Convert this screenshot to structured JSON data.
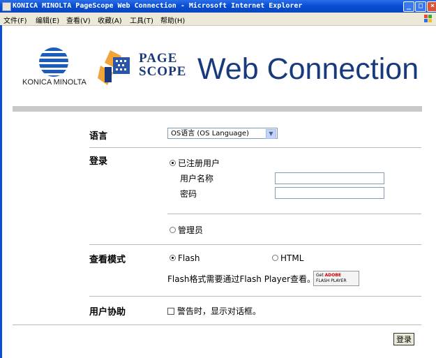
{
  "window": {
    "title": "KONICA MINOLTA PageScope Web Connection - Microsoft Internet Explorer",
    "buttons": {
      "minimize": "_",
      "maximize": "□",
      "close": "×"
    }
  },
  "menu": {
    "items": [
      "文件(F)",
      "编辑(E)",
      "查看(V)",
      "收藏(A)",
      "工具(T)",
      "帮助(H)"
    ]
  },
  "header": {
    "company_logo_text": "KONICA MINOLTA",
    "pagescope_line1": "PAGE",
    "pagescope_line2": "SCOPE",
    "product_title": "Web Connection"
  },
  "form": {
    "language": {
      "label": "语言",
      "selected": "OS语言 (OS Language)"
    },
    "login": {
      "label": "登录",
      "registered_user": "已注册用户",
      "username_label": "用户名称",
      "username_value": "",
      "password_label": "密码",
      "password_value": "",
      "administrator": "管理员"
    },
    "view_mode": {
      "label": "查看模式",
      "option_flash": "Flash",
      "option_html": "HTML",
      "note": "Flash格式需要通过Flash Player查看。",
      "badge_get": "Get",
      "badge_adobe": "ADOBE",
      "badge_player": "FLASH PLAYER"
    },
    "assist": {
      "label": "用户协助",
      "checkbox_text": "警告时，显示对话框。"
    },
    "submit_label": "登录"
  }
}
